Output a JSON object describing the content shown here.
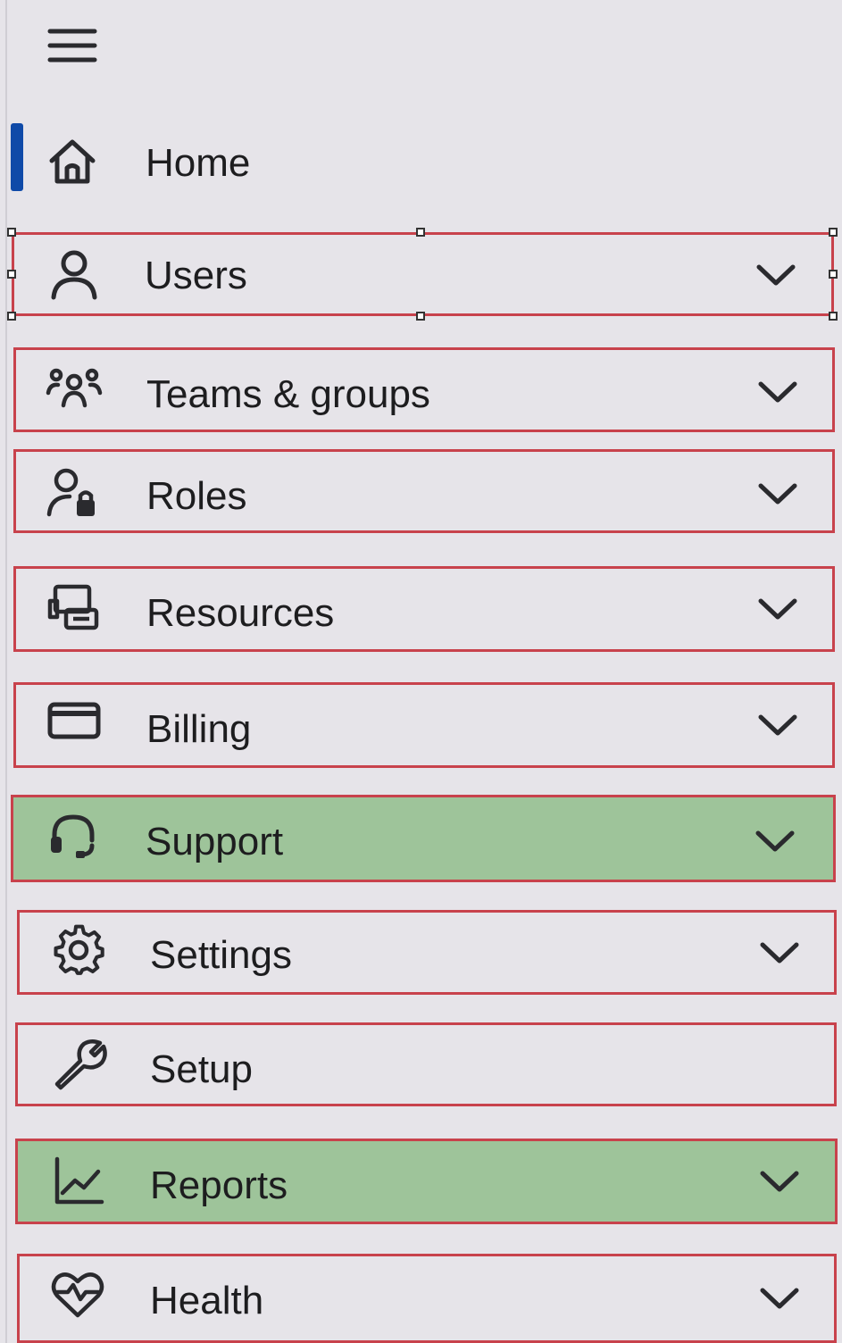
{
  "nav": {
    "items": [
      {
        "label": "Home",
        "icon": "home-icon",
        "expandable": false,
        "active": true
      },
      {
        "label": "Users",
        "icon": "person-icon",
        "expandable": true,
        "selected": true
      },
      {
        "label": "Teams & groups",
        "icon": "people-group-icon",
        "expandable": true
      },
      {
        "label": "Roles",
        "icon": "person-lock-icon",
        "expandable": true
      },
      {
        "label": "Resources",
        "icon": "resources-icon",
        "expandable": true
      },
      {
        "label": "Billing",
        "icon": "credit-card-icon",
        "expandable": true
      },
      {
        "label": "Support",
        "icon": "headset-icon",
        "expandable": true,
        "highlighted": true
      },
      {
        "label": "Settings",
        "icon": "gear-icon",
        "expandable": true
      },
      {
        "label": "Setup",
        "icon": "wrench-icon",
        "expandable": false
      },
      {
        "label": "Reports",
        "icon": "line-chart-icon",
        "expandable": true,
        "highlighted": true
      },
      {
        "label": "Health",
        "icon": "heart-pulse-icon",
        "expandable": true
      }
    ]
  },
  "colors": {
    "background": "#e6e4e9",
    "active_indicator": "#0f4aa8",
    "box_outline": "#c8424c",
    "highlight_fill": "#9ec49a",
    "text": "#1d1d1f"
  }
}
